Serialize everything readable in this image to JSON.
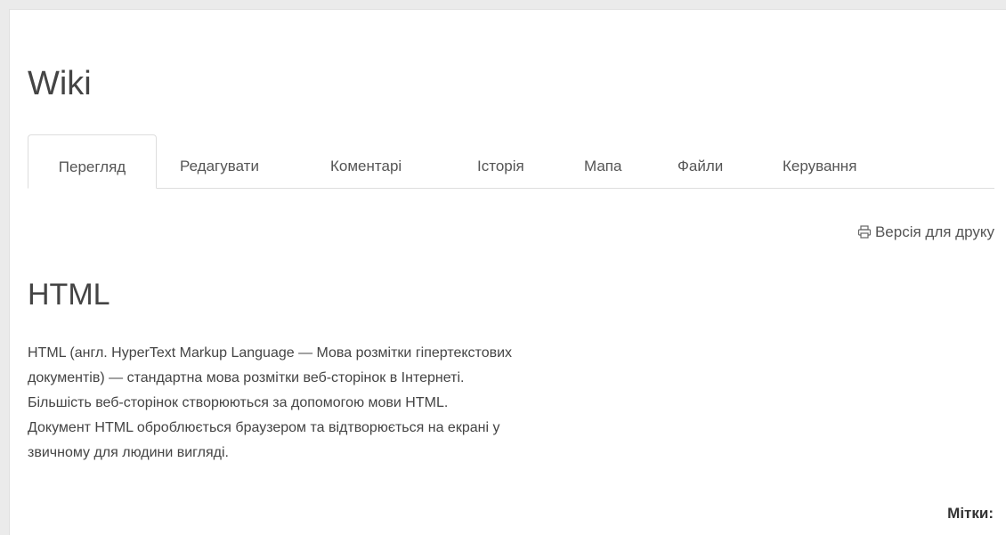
{
  "wiki": {
    "title": "Wiki"
  },
  "tabs": [
    {
      "label": "Перегляд",
      "active": true
    },
    {
      "label": "Редагувати",
      "active": false
    },
    {
      "label": "Коментарі",
      "active": false
    },
    {
      "label": "Історія",
      "active": false
    },
    {
      "label": "Мапа",
      "active": false
    },
    {
      "label": "Файли",
      "active": false
    },
    {
      "label": "Керування",
      "active": false
    }
  ],
  "print": {
    "label": "Версія для друку",
    "icon": "printer-icon"
  },
  "page": {
    "heading": "HTML",
    "content_lines": [
      "HTML (англ. HyperText Markup Language — Мова розмітки гіпертекстових",
      "документів) — стандартна мова розмітки веб-сторінок в Інтернеті.",
      "Більшість веб-сторінок створюються за допомогою мови HTML.",
      "Документ HTML оброблюється браузером та відтворюється на екрані у",
      "звичному для людини вигляді."
    ],
    "tags_label": "Мітки:"
  },
  "colors": {
    "background": "#ebebeb",
    "panel": "#ffffff",
    "border": "#dddddd",
    "text": "#444444"
  }
}
